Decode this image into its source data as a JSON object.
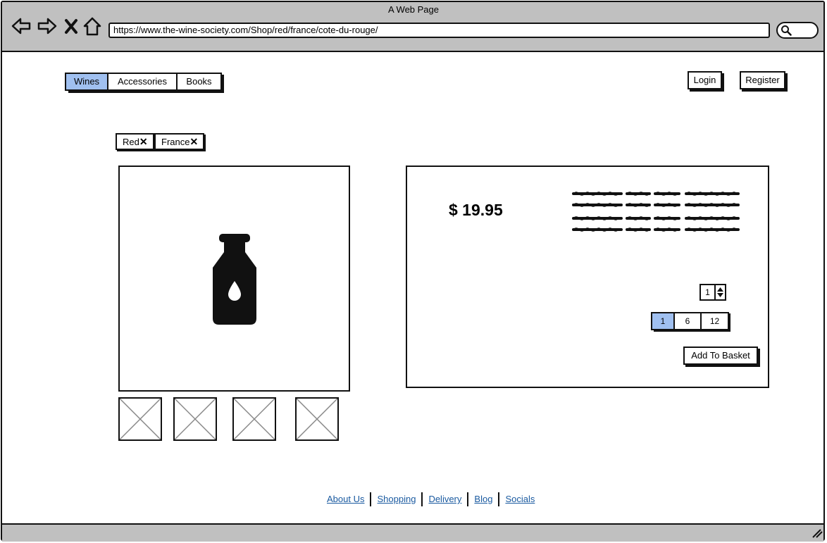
{
  "window": {
    "title": "A Web Page"
  },
  "browser": {
    "url": "https://www.the-wine-society.com/Shop/red/france/cote-du-rouge/",
    "icons": [
      "back-arrow-icon",
      "forward-arrow-icon",
      "close-icon",
      "home-icon",
      "search-icon"
    ]
  },
  "nav": {
    "tabs": [
      {
        "label": "Wines",
        "active": true
      },
      {
        "label": "Accessories",
        "active": false
      },
      {
        "label": "Books",
        "active": false
      }
    ],
    "login": "Login",
    "register": "Register"
  },
  "filters": [
    {
      "label": "Red",
      "remove_icon": "close-icon"
    },
    {
      "label": "France",
      "remove_icon": "close-icon"
    }
  ],
  "product": {
    "image_icon": "wine-bottle-icon",
    "thumbnails": 4,
    "price": "$ 19.95",
    "quantity": "1",
    "pack_sizes": [
      {
        "label": "1",
        "active": true
      },
      {
        "label": "6",
        "active": false
      },
      {
        "label": "12",
        "active": false
      }
    ],
    "add_to_basket": "Add To Basket"
  },
  "footer": {
    "links": [
      "About Us",
      "Shopping",
      "Delivery",
      "Blog",
      "Socials"
    ]
  },
  "colors": {
    "accent": "#a0c0f0",
    "chrome": "#c0c0c0",
    "link": "#1a5aa0"
  }
}
